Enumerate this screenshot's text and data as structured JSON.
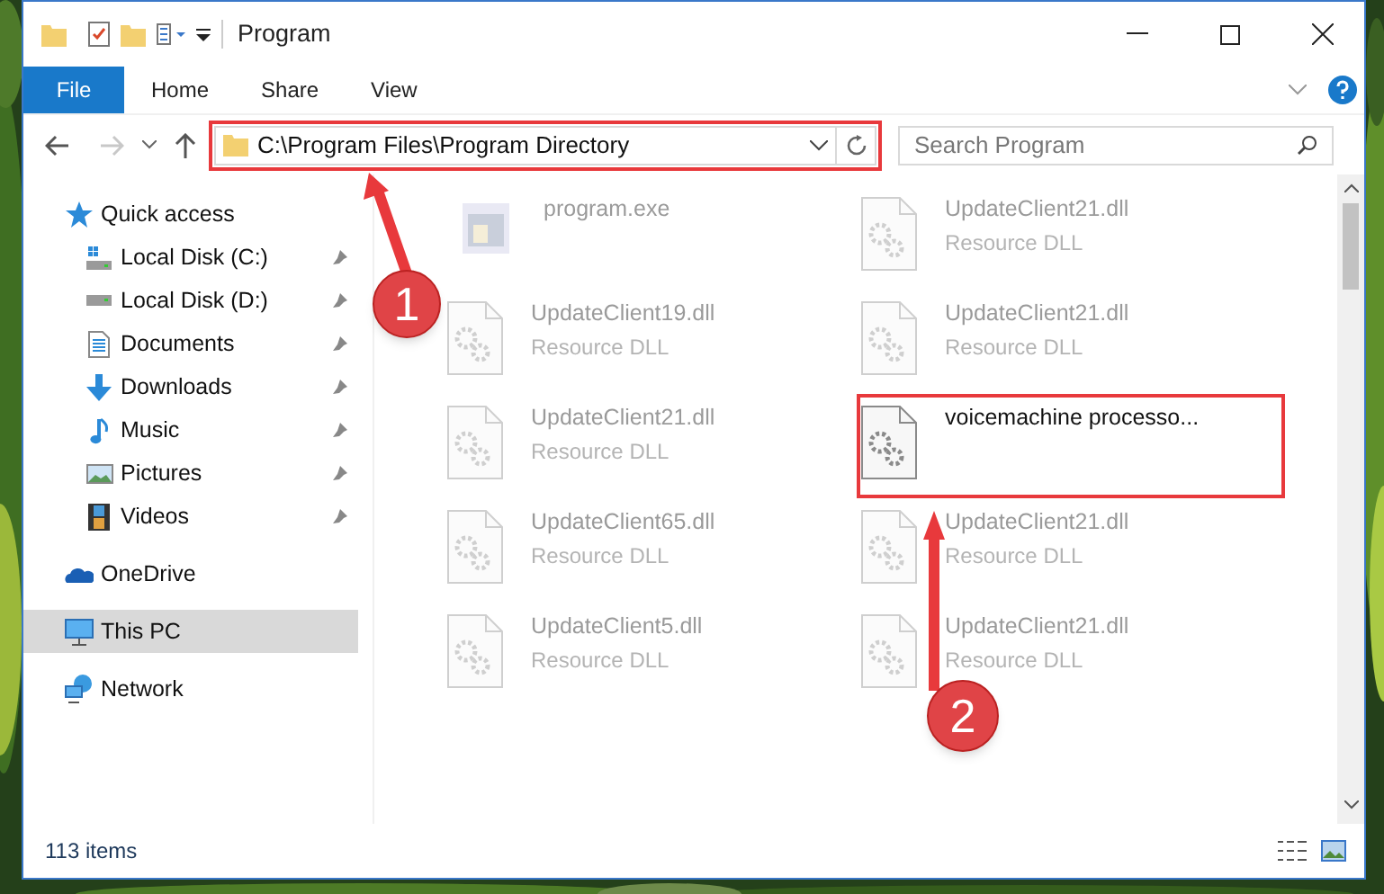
{
  "window": {
    "title": "Program"
  },
  "ribbon_tabs": [
    {
      "label": "File",
      "selected": true
    },
    {
      "label": "Home",
      "selected": false
    },
    {
      "label": "Share",
      "selected": false
    },
    {
      "label": "View",
      "selected": false
    }
  ],
  "address": {
    "path": "C:\\Program Files\\Program Directory",
    "highlighted": true
  },
  "search": {
    "placeholder": "Search Program"
  },
  "nav": [
    {
      "label": "Quick access",
      "kind": "star",
      "pinned": false,
      "selected": false,
      "children": [
        {
          "label": "Local Disk (C:)",
          "kind": "disk-c",
          "pinned": true,
          "selected": false
        },
        {
          "label": "Local Disk (D:)",
          "kind": "disk",
          "pinned": true,
          "selected": false
        },
        {
          "label": "Documents",
          "kind": "documents",
          "pinned": true,
          "selected": false
        },
        {
          "label": "Downloads",
          "kind": "downloads",
          "pinned": true,
          "selected": false
        },
        {
          "label": "Music",
          "kind": "music",
          "pinned": true,
          "selected": false
        },
        {
          "label": "Pictures",
          "kind": "pictures",
          "pinned": true,
          "selected": false
        },
        {
          "label": "Videos",
          "kind": "videos",
          "pinned": true,
          "selected": false
        }
      ]
    },
    {
      "label": "OneDrive",
      "kind": "cloud",
      "pinned": false,
      "selected": false
    },
    {
      "label": "This PC",
      "kind": "pc",
      "pinned": false,
      "selected": true
    },
    {
      "label": "Network",
      "kind": "network",
      "pinned": false,
      "selected": false
    }
  ],
  "files": [
    {
      "name": "program.exe",
      "kind": "exe",
      "blurred": true,
      "highlighted": false
    },
    {
      "name": "UpdateClient21.dll",
      "type": "Resource DLL",
      "kind": "dll",
      "blurred": true,
      "highlighted": false
    },
    {
      "name": "UpdateClient19.dll",
      "type": "Resource DLL",
      "kind": "dll",
      "blurred": true,
      "highlighted": false
    },
    {
      "name": "UpdateClient21.dll",
      "type": "Resource DLL",
      "kind": "dll",
      "blurred": true,
      "highlighted": false
    },
    {
      "name": "UpdateClient21.dll",
      "type": "Resource DLL",
      "kind": "dll",
      "blurred": true,
      "highlighted": false
    },
    {
      "name": "voicemachine processo...",
      "kind": "dll",
      "blurred": false,
      "highlighted": true
    },
    {
      "name": "UpdateClient65.dll",
      "type": "Resource DLL",
      "kind": "dll",
      "blurred": true,
      "highlighted": false
    },
    {
      "name": "UpdateClient21.dll",
      "type": "Resource DLL",
      "kind": "dll",
      "blurred": true,
      "highlighted": false
    },
    {
      "name": "UpdateClient5.dll",
      "type": "Resource DLL",
      "kind": "dll",
      "blurred": true,
      "highlighted": false
    },
    {
      "name": "UpdateClient21.dll",
      "type": "Resource DLL",
      "kind": "dll",
      "blurred": true,
      "highlighted": false
    }
  ],
  "annotations": [
    {
      "number": "1"
    },
    {
      "number": "2"
    }
  ],
  "status_bar": {
    "count": "113 items"
  }
}
